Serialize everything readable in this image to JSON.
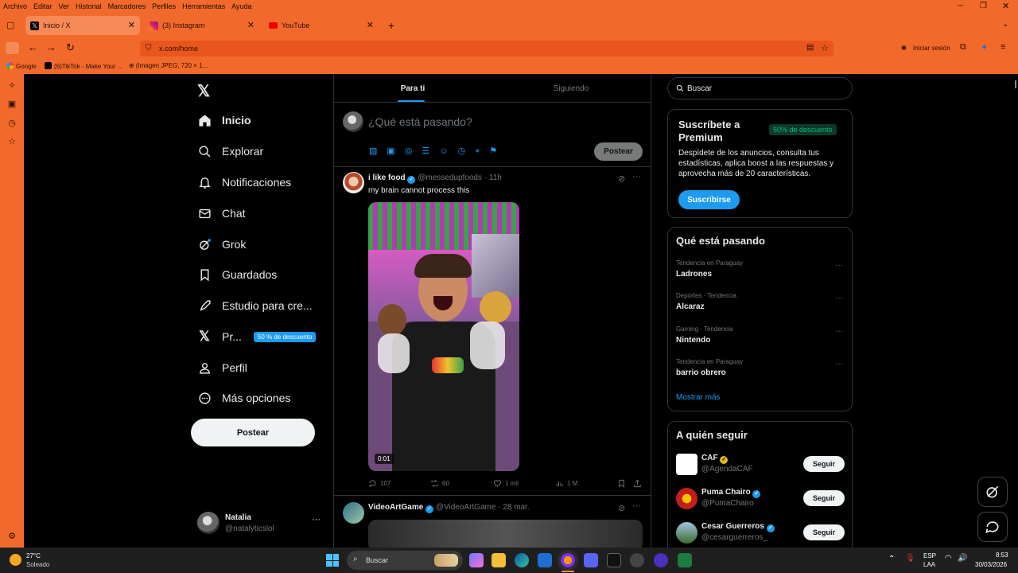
{
  "menubar": [
    "Archivo",
    "Editar",
    "Ver",
    "Historial",
    "Marcadores",
    "Perfiles",
    "Herramientas",
    "Ayuda"
  ],
  "tabs": [
    {
      "label": "Inicio / X",
      "active": true
    },
    {
      "label": "(3) Instagram",
      "active": false
    },
    {
      "label": "YouTube",
      "active": false
    }
  ],
  "url": "x.com/home",
  "signin": "Iniciar sesión",
  "bookmarks": [
    "Google",
    "(6)TikTok - Make Your ...",
    "(Imagen JPEG, 720 × 1..."
  ],
  "nav": {
    "items": [
      "Inicio",
      "Explorar",
      "Notificaciones",
      "Chat",
      "Grok",
      "Guardados",
      "Estudio para cre...",
      "Pr...",
      "Perfil",
      "Más opciones"
    ],
    "premium_badge": "50 % de descuento",
    "post_button": "Postear",
    "user_name": "Natalia",
    "user_handle": "@natalyticslol"
  },
  "feed": {
    "tabs": [
      "Para ti",
      "Siguiendo"
    ],
    "composer_placeholder": "¿Qué está pasando?",
    "composer_button": "Postear",
    "post1": {
      "name": "i like food",
      "handle": "@messedupfoods",
      "time": "· 11h",
      "text": "my brain cannot process this",
      "video_time": "0:01",
      "replies": "107",
      "reposts": "60",
      "likes": "1 mil",
      "views": "1 M"
    },
    "post2": {
      "name": "VideoArtGame",
      "handle": "@VideoArtGame",
      "time": "· 28 mar."
    }
  },
  "right": {
    "search_placeholder": "Buscar",
    "premium": {
      "title": "Suscríbete a Premium",
      "badge": "50% de descuento",
      "text": "Despídete de los anuncios, consulta tus estadísticas, aplica boost a las respuestas y aprovecha más de 20 características.",
      "button": "Suscribirse"
    },
    "trends": {
      "title": "Qué está pasando",
      "items": [
        {
          "cat": "Tendencia en Paraguay",
          "name": "Ladrones"
        },
        {
          "cat": "Deportes · Tendencia",
          "name": "Alcaraz"
        },
        {
          "cat": "Gaming · Tendencia",
          "name": "Nintendo"
        },
        {
          "cat": "Tendencia en Paraguay",
          "name": "barrio obrero"
        }
      ],
      "more": "Mostrar más"
    },
    "follow": {
      "title": "A quién seguir",
      "button": "Seguir",
      "items": [
        {
          "name": "CAF",
          "handle": "@AgendaCAF"
        },
        {
          "name": "Puma Chairo",
          "handle": "@PumaChairo"
        },
        {
          "name": "Cesar Guerreros",
          "handle": "@cesarguerreros_"
        }
      ]
    }
  },
  "taskbar": {
    "temp": "27°C",
    "weather": "Soleado",
    "search": "Buscar",
    "lang1": "ESP",
    "lang2": "LAA",
    "time": "8:53",
    "date": "30/03/2026"
  },
  "colors": {
    "browser": "#f26a2b",
    "accent": "#1d9bf0",
    "premium_green": "#00ba7c"
  }
}
